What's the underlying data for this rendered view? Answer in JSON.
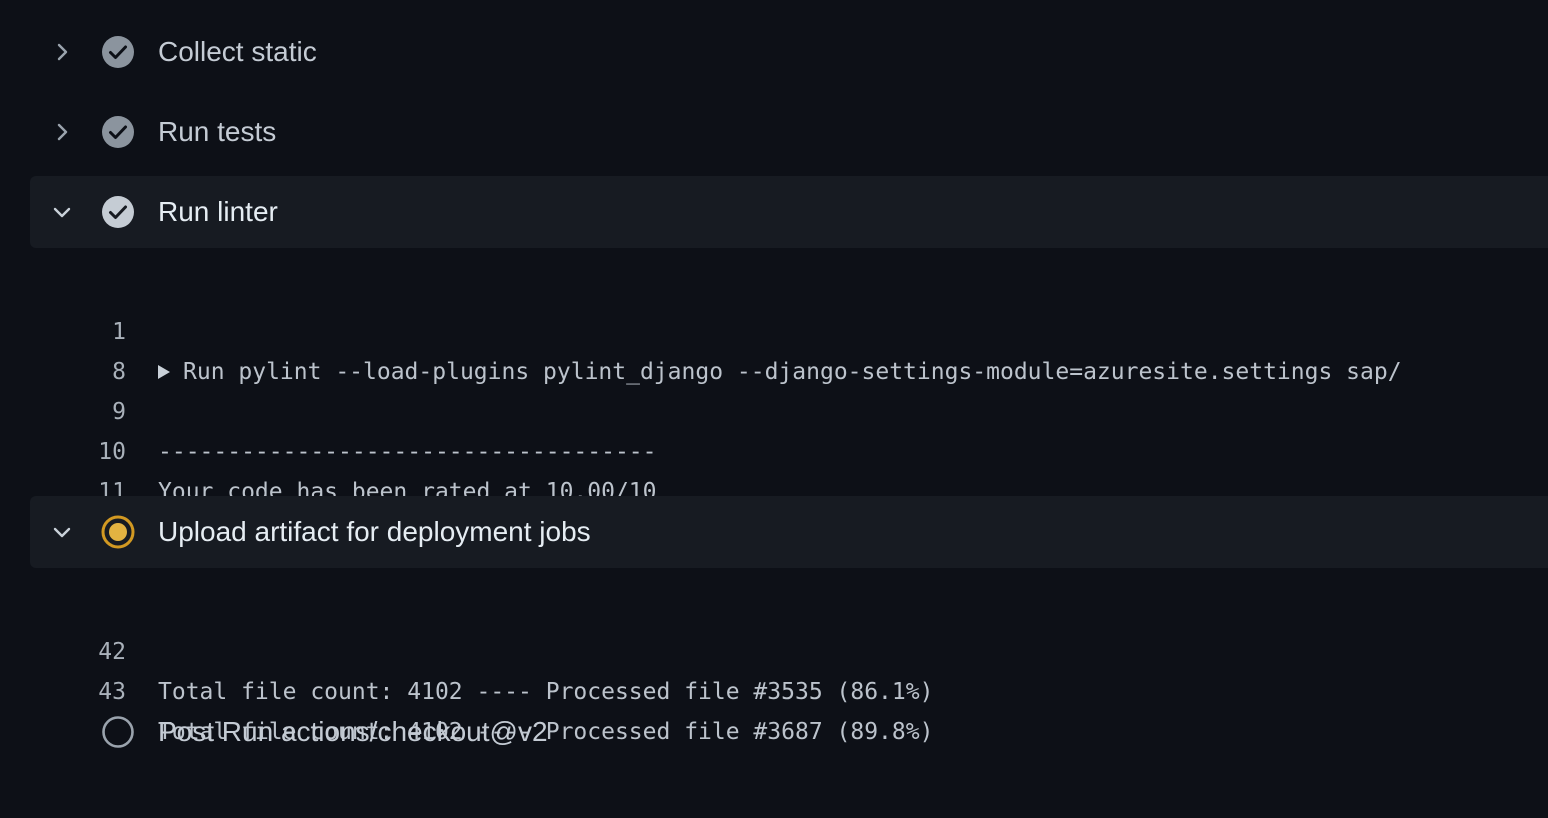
{
  "steps": [
    {
      "title": "Collect static",
      "status": "success",
      "expanded": false
    },
    {
      "title": "Run tests",
      "status": "success",
      "expanded": false
    },
    {
      "title": "Run linter",
      "status": "success",
      "expanded": true
    },
    {
      "title": "Upload artifact for deployment jobs",
      "status": "in-progress",
      "expanded": true
    },
    {
      "title": "Post Run actions/checkout@v2",
      "status": "pending",
      "expanded": false
    }
  ],
  "linter_log": [
    {
      "num": "1",
      "text": "Run pylint --load-plugins pylint_django --django-settings-module=azuresite.settings sap/",
      "group": true
    },
    {
      "num": "8",
      "text": ""
    },
    {
      "num": "9",
      "text": "------------------------------------"
    },
    {
      "num": "10",
      "text": "Your code has been rated at 10.00/10"
    },
    {
      "num": "11",
      "text": ""
    }
  ],
  "upload_log": [
    {
      "num": "42",
      "text": "Total file count: 4102 ---- Processed file #3535 (86.1%)"
    },
    {
      "num": "43",
      "text": "Total file count: 4102 ---- Processed file #3687 (89.8%)"
    }
  ],
  "icons": {
    "chevron_right": "chevron-right-icon",
    "chevron_down": "chevron-down-icon",
    "success": "check-circle-icon",
    "in_progress": "in-progress-icon",
    "pending": "empty-circle-icon"
  },
  "colors": {
    "background": "#0d1017",
    "expanded_header": "#171b22",
    "success_icon": "#8b949e",
    "in_progress": "#d29922"
  }
}
